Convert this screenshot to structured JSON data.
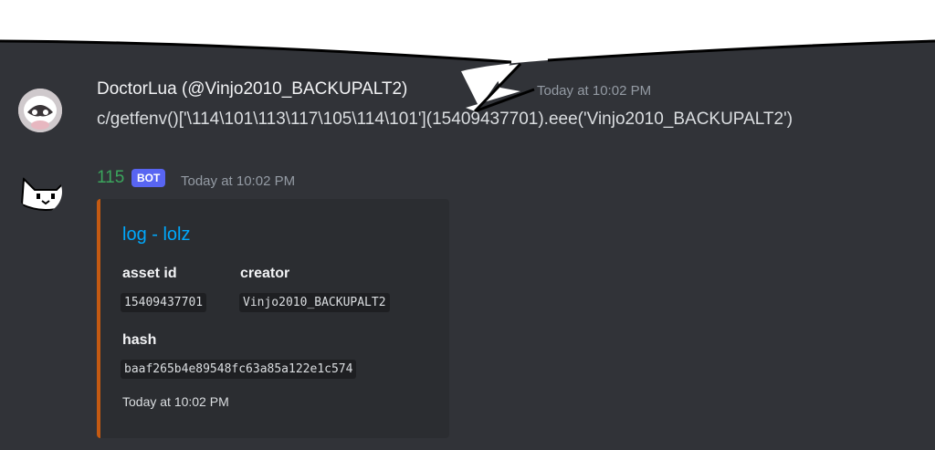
{
  "colors": {
    "background": "#313338",
    "embed_background": "#2b2d31",
    "embed_accent": "#c45a12",
    "link": "#00a8fc",
    "bot_name": "#3ba55d",
    "badge": "#5865f2"
  },
  "messages": [
    {
      "author": "DoctorLua (@Vinjo2010_BACKUPALT2)",
      "timestamp": "Today at 10:02 PM",
      "content": "c/getfenv()['\\114\\101\\113\\117\\105\\114\\101'](15409437701).eee('Vinjo2010_BACKUPALT2')"
    },
    {
      "author": "115",
      "badge": "BOT",
      "timestamp": "Today at 10:02 PM",
      "embed": {
        "title": "log - lolz",
        "fields": [
          {
            "name": "asset id",
            "value": "15409437701"
          },
          {
            "name": "creator",
            "value": "Vinjo2010_BACKUPALT2"
          },
          {
            "name": "hash",
            "value": "baaf265b4e89548fc63a85a122e1c574"
          }
        ],
        "footer": "Today at 10:02 PM"
      }
    }
  ]
}
